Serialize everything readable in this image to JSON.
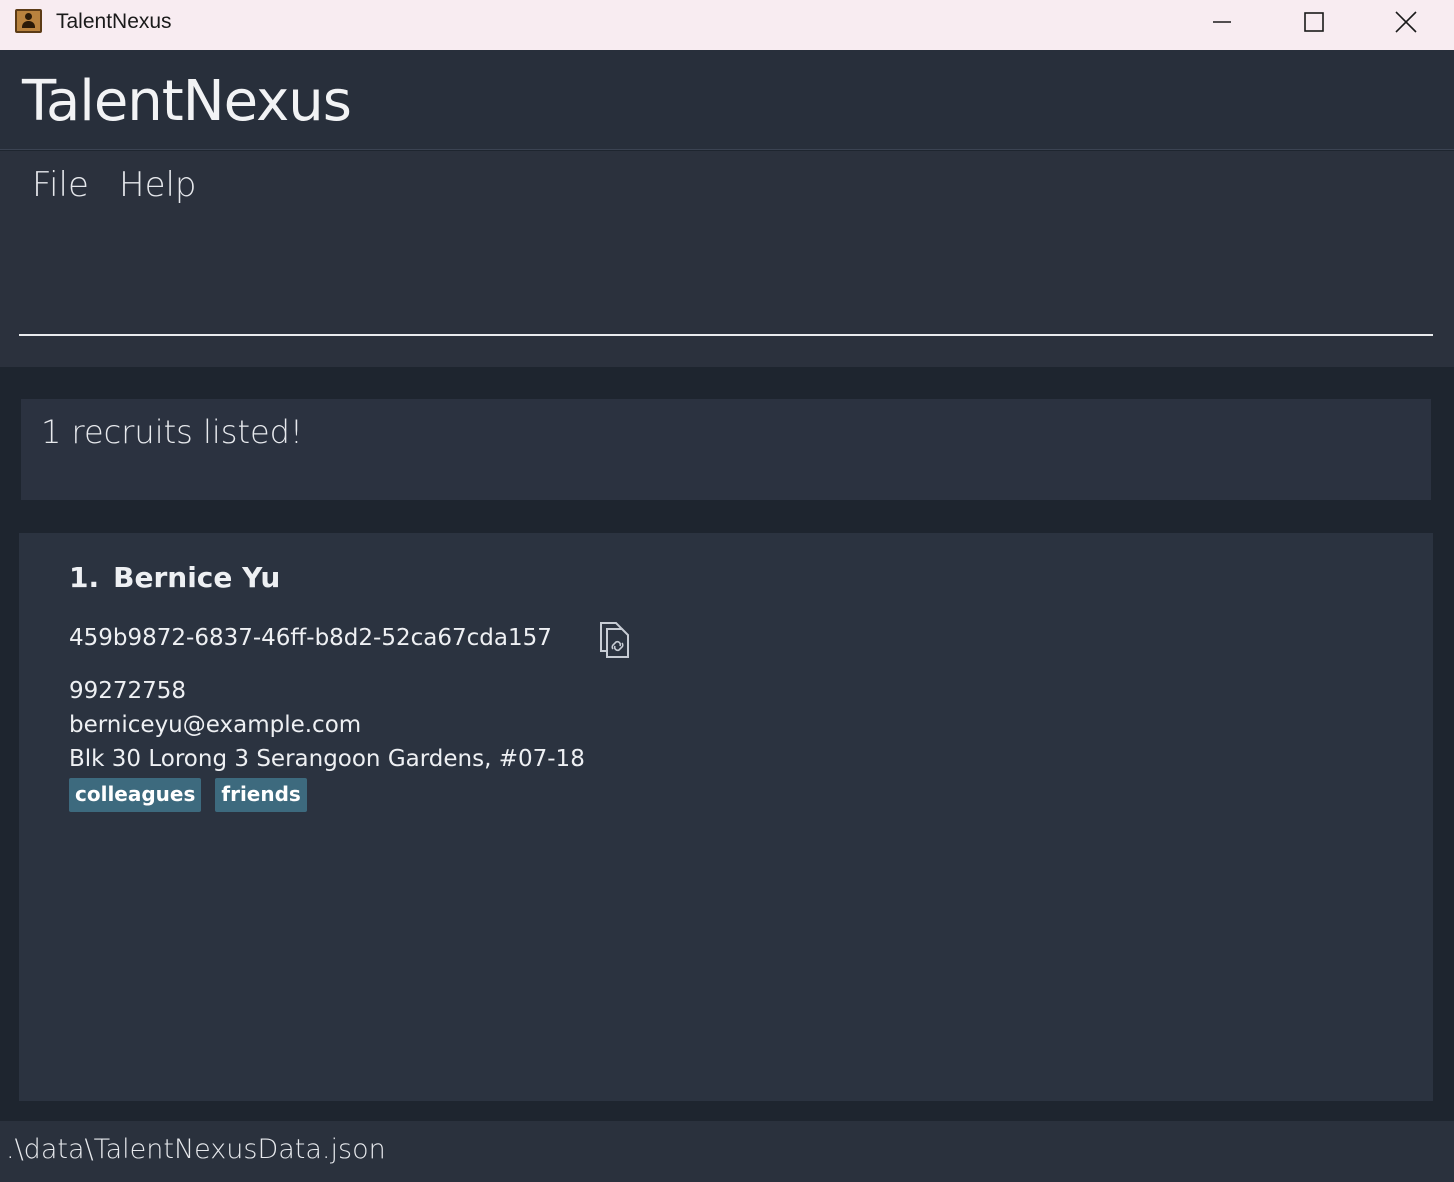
{
  "window": {
    "title": "TalentNexus",
    "icon": "contact-book-icon"
  },
  "header": {
    "title": "TalentNexus"
  },
  "menu": {
    "items": [
      {
        "label": "File"
      },
      {
        "label": "Help"
      }
    ]
  },
  "command": {
    "value": "",
    "placeholder": ""
  },
  "result": {
    "message": "1 recruits listed!"
  },
  "recruits": [
    {
      "index": "1.",
      "name": "Bernice Yu",
      "id": "459b9872-6837-46ff-b8d2-52ca67cda157",
      "phone": "99272758",
      "email": "berniceyu@example.com",
      "address": "Blk 30 Lorong 3 Serangoon Gardens, #07-18",
      "tags": [
        "colleagues",
        "friends"
      ]
    }
  ],
  "status": {
    "file_path": ".\\data\\TalentNexusData.json"
  },
  "colors": {
    "background": "#1e252f",
    "panel": "#2b3340",
    "tag": "#3d6a7e",
    "titlebar": "#f8ecf1"
  }
}
